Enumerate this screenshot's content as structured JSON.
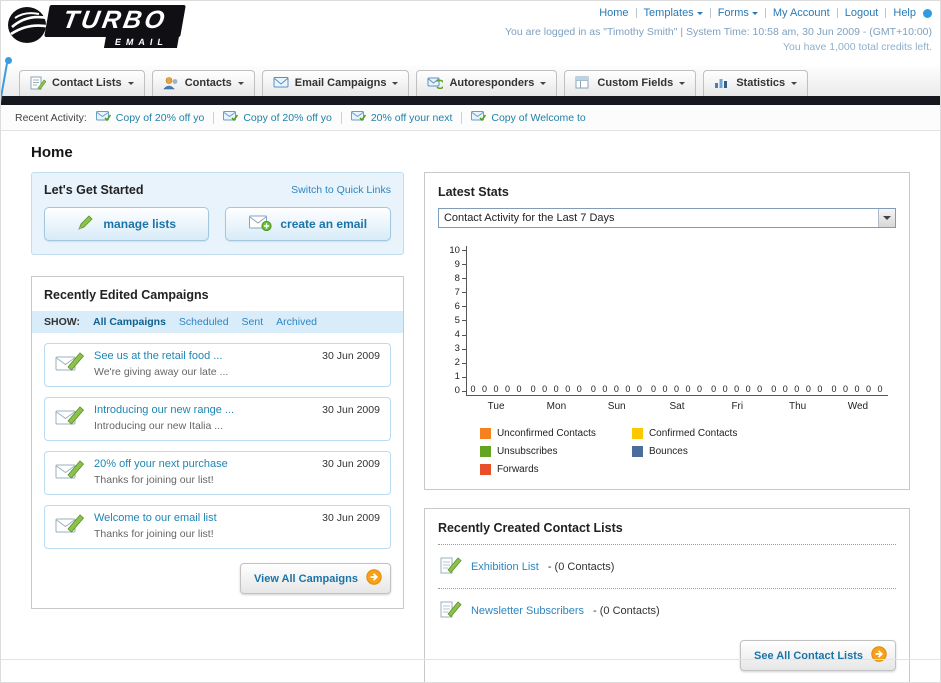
{
  "header": {
    "logo_primary": "TURBO",
    "logo_secondary": "EMAIL",
    "nav_links": [
      {
        "label": "Home",
        "caret": false
      },
      {
        "label": "Templates",
        "caret": true
      },
      {
        "label": "Forms",
        "caret": true
      },
      {
        "label": "My Account",
        "caret": false
      },
      {
        "label": "Logout",
        "caret": false
      },
      {
        "label": "Help",
        "caret": false
      }
    ],
    "session_text": "You are logged in as \"Timothy Smith\" | System Time: 10:58 am, 30 Jun 2009 - (GMT+10:00)",
    "credits_text": "You have 1,000 total credits left."
  },
  "nav_tabs": [
    {
      "label": "Contact Lists"
    },
    {
      "label": "Contacts"
    },
    {
      "label": "Email Campaigns"
    },
    {
      "label": "Autoresponders"
    },
    {
      "label": "Custom Fields"
    },
    {
      "label": "Statistics"
    }
  ],
  "recent_activity": {
    "label": "Recent Activity:",
    "items": [
      "Copy of 20% off yo",
      "Copy of 20% off yo",
      "20% off your next",
      "Copy of Welcome to"
    ]
  },
  "page_title": "Home",
  "get_started": {
    "title": "Let's Get Started",
    "switch_link": "Switch to Quick Links",
    "manage_button": "manage lists",
    "create_button": "create an email"
  },
  "campaigns": {
    "title": "Recently Edited Campaigns",
    "show_label": "SHOW:",
    "tabs": [
      "All Campaigns",
      "Scheduled",
      "Sent",
      "Archived"
    ],
    "active_tab": "All Campaigns",
    "items": [
      {
        "title": "See us at the retail food ...",
        "subtitle": "We're giving away our late ...",
        "date": "30 Jun 2009"
      },
      {
        "title": "Introducing our new range ...",
        "subtitle": "Introducing our new Italia ...",
        "date": "30 Jun 2009"
      },
      {
        "title": "20% off your next purchase",
        "subtitle": "Thanks for joining our list!",
        "date": "30 Jun 2009"
      },
      {
        "title": "Welcome to our email list",
        "subtitle": "Thanks for joining our list!",
        "date": "30 Jun 2009"
      }
    ],
    "view_all_label": "View All Campaigns"
  },
  "stats": {
    "title": "Latest Stats",
    "dropdown_value": "Contact Activity for the Last 7 Days",
    "chart_data": {
      "type": "bar",
      "title": "Contact Activity for the Last 7 Days",
      "categories": [
        "Tue",
        "Mon",
        "Sun",
        "Sat",
        "Fri",
        "Thu",
        "Wed"
      ],
      "series": [
        {
          "name": "Unconfirmed Contacts",
          "color": "#f5821f",
          "values": [
            0,
            0,
            0,
            0,
            0,
            0,
            0
          ]
        },
        {
          "name": "Confirmed Contacts",
          "color": "#fdc800",
          "values": [
            0,
            0,
            0,
            0,
            0,
            0,
            0
          ]
        },
        {
          "name": "Unsubscribes",
          "color": "#61a521",
          "values": [
            0,
            0,
            0,
            0,
            0,
            0,
            0
          ]
        },
        {
          "name": "Bounces",
          "color": "#4a6d9e",
          "values": [
            0,
            0,
            0,
            0,
            0,
            0,
            0
          ]
        },
        {
          "name": "Forwards",
          "color": "#e8502a",
          "values": [
            0,
            0,
            0,
            0,
            0,
            0,
            0
          ]
        }
      ],
      "ylim": [
        0,
        10
      ],
      "ytick_step": 1,
      "grid": false,
      "legend_position": "bottom"
    }
  },
  "contact_lists": {
    "title": "Recently Created Contact Lists",
    "items": [
      {
        "name": "Exhibition List",
        "detail": "- (0 Contacts)"
      },
      {
        "name": "Newsletter Subscribers",
        "detail": "- (0 Contacts)"
      }
    ],
    "see_all_label": "See All Contact Lists"
  },
  "icons": {
    "caret-down-icon": "▾",
    "envelope-icon": "✉",
    "pencil-icon": "✎",
    "plus-icon": "+",
    "arrow-right-icon": "➜",
    "help-icon": "●"
  },
  "colors": {
    "link_blue": "#2d86c3",
    "dark_bar": "#17171f",
    "accent_orange": "#f7a11a",
    "panel_blue_bg": "#e8f3fb"
  }
}
